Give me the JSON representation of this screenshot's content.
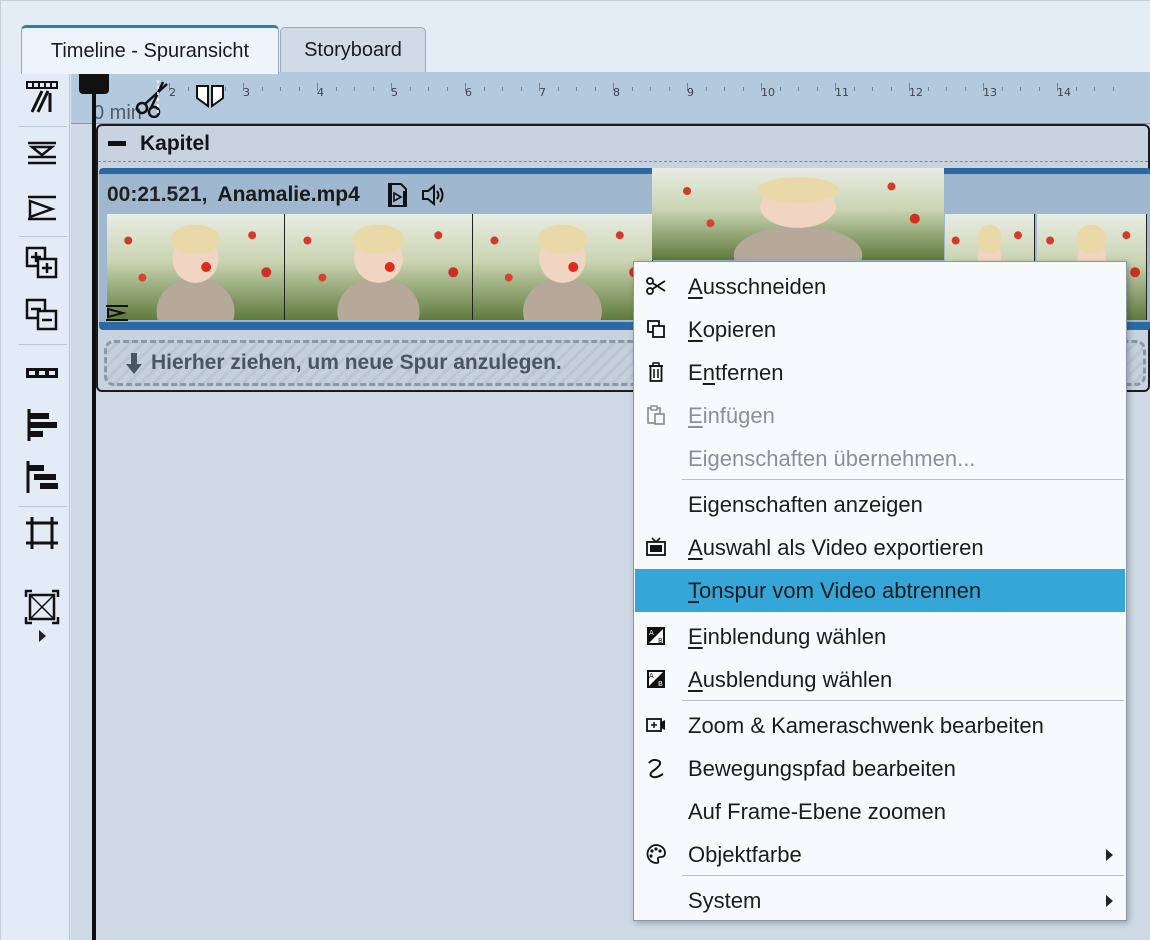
{
  "tabs": [
    {
      "label": "Timeline - Spuransicht",
      "active": true
    },
    {
      "label": "Storyboard",
      "active": false
    }
  ],
  "toolbar": {
    "icons": [
      "track-tool-icon",
      "align-center-icon",
      "transition-icon",
      "add-track-icon",
      "remove-track-icon",
      "filmstrip-icon",
      "align-left-icon",
      "align-right-icon",
      "frame-crop-icon",
      "fit-frame-icon"
    ]
  },
  "ruler": {
    "unit_label": "0 min",
    "ticks": [
      "2",
      "3",
      "4",
      "5",
      "6",
      "7",
      "8",
      "9",
      "10",
      "11",
      "12",
      "13",
      "14"
    ]
  },
  "chapter": {
    "title": "Kapitel"
  },
  "clip": {
    "time": "00:21.521,",
    "name": "Anamalie.mp4"
  },
  "dropzone": {
    "text": "Hierher ziehen, um neue Spur anzulegen."
  },
  "menu": {
    "items": [
      {
        "pre": "",
        "u": "A",
        "post": "usschneiden",
        "icon": "scissors-icon",
        "disabled": false,
        "highlighted": false,
        "submenu": false
      },
      {
        "pre": "",
        "u": "K",
        "post": "opieren",
        "icon": "copy-icon",
        "disabled": false,
        "highlighted": false,
        "submenu": false
      },
      {
        "pre": "E",
        "u": "n",
        "post": "tfernen",
        "icon": "trash-icon",
        "disabled": false,
        "highlighted": false,
        "submenu": false
      },
      {
        "pre": "",
        "u": "E",
        "post": "infügen",
        "icon": "paste-icon",
        "disabled": true,
        "highlighted": false,
        "submenu": false
      },
      {
        "pre": "Eigenschaften übernehmen...",
        "u": "",
        "post": "",
        "icon": "",
        "disabled": true,
        "highlighted": false,
        "submenu": false
      },
      {
        "pre": "Eigenschaften anzeigen",
        "u": "",
        "post": "",
        "icon": "",
        "disabled": false,
        "highlighted": false,
        "submenu": false
      },
      {
        "pre": "",
        "u": "A",
        "post": "uswahl als Video exportieren",
        "icon": "tv-export-icon",
        "disabled": false,
        "highlighted": false,
        "submenu": false
      },
      {
        "pre": "",
        "u": "T",
        "post": "onspur vom Video abtrennen",
        "icon": "",
        "disabled": false,
        "highlighted": true,
        "submenu": false
      },
      {
        "pre": "",
        "u": "E",
        "post": "inblendung wählen",
        "icon": "fade-in-icon",
        "disabled": false,
        "highlighted": false,
        "submenu": false
      },
      {
        "pre": "",
        "u": "A",
        "post": "usblendung wählen",
        "icon": "fade-out-icon",
        "disabled": false,
        "highlighted": false,
        "submenu": false
      },
      {
        "pre": "Zoom & Kameraschwenk bearbeiten",
        "u": "",
        "post": "",
        "icon": "zoom-pan-icon",
        "disabled": false,
        "highlighted": false,
        "submenu": false
      },
      {
        "pre": "Bewegungspfad bearbeiten",
        "u": "",
        "post": "",
        "icon": "motion-path-icon",
        "disabled": false,
        "highlighted": false,
        "submenu": false
      },
      {
        "pre": "Auf Frame-Ebene zoomen",
        "u": "",
        "post": "",
        "icon": "",
        "disabled": false,
        "highlighted": false,
        "submenu": false
      },
      {
        "pre": "Objektfarbe",
        "u": "",
        "post": "",
        "icon": "palette-icon",
        "disabled": false,
        "highlighted": false,
        "submenu": true
      },
      {
        "pre": "System",
        "u": "",
        "post": "",
        "icon": "",
        "disabled": false,
        "highlighted": false,
        "submenu": true
      }
    ]
  },
  "colors": {
    "highlight": "#34a6d8",
    "tab_accent": "#2d7db6",
    "clip_border": "#2c6aa3"
  }
}
